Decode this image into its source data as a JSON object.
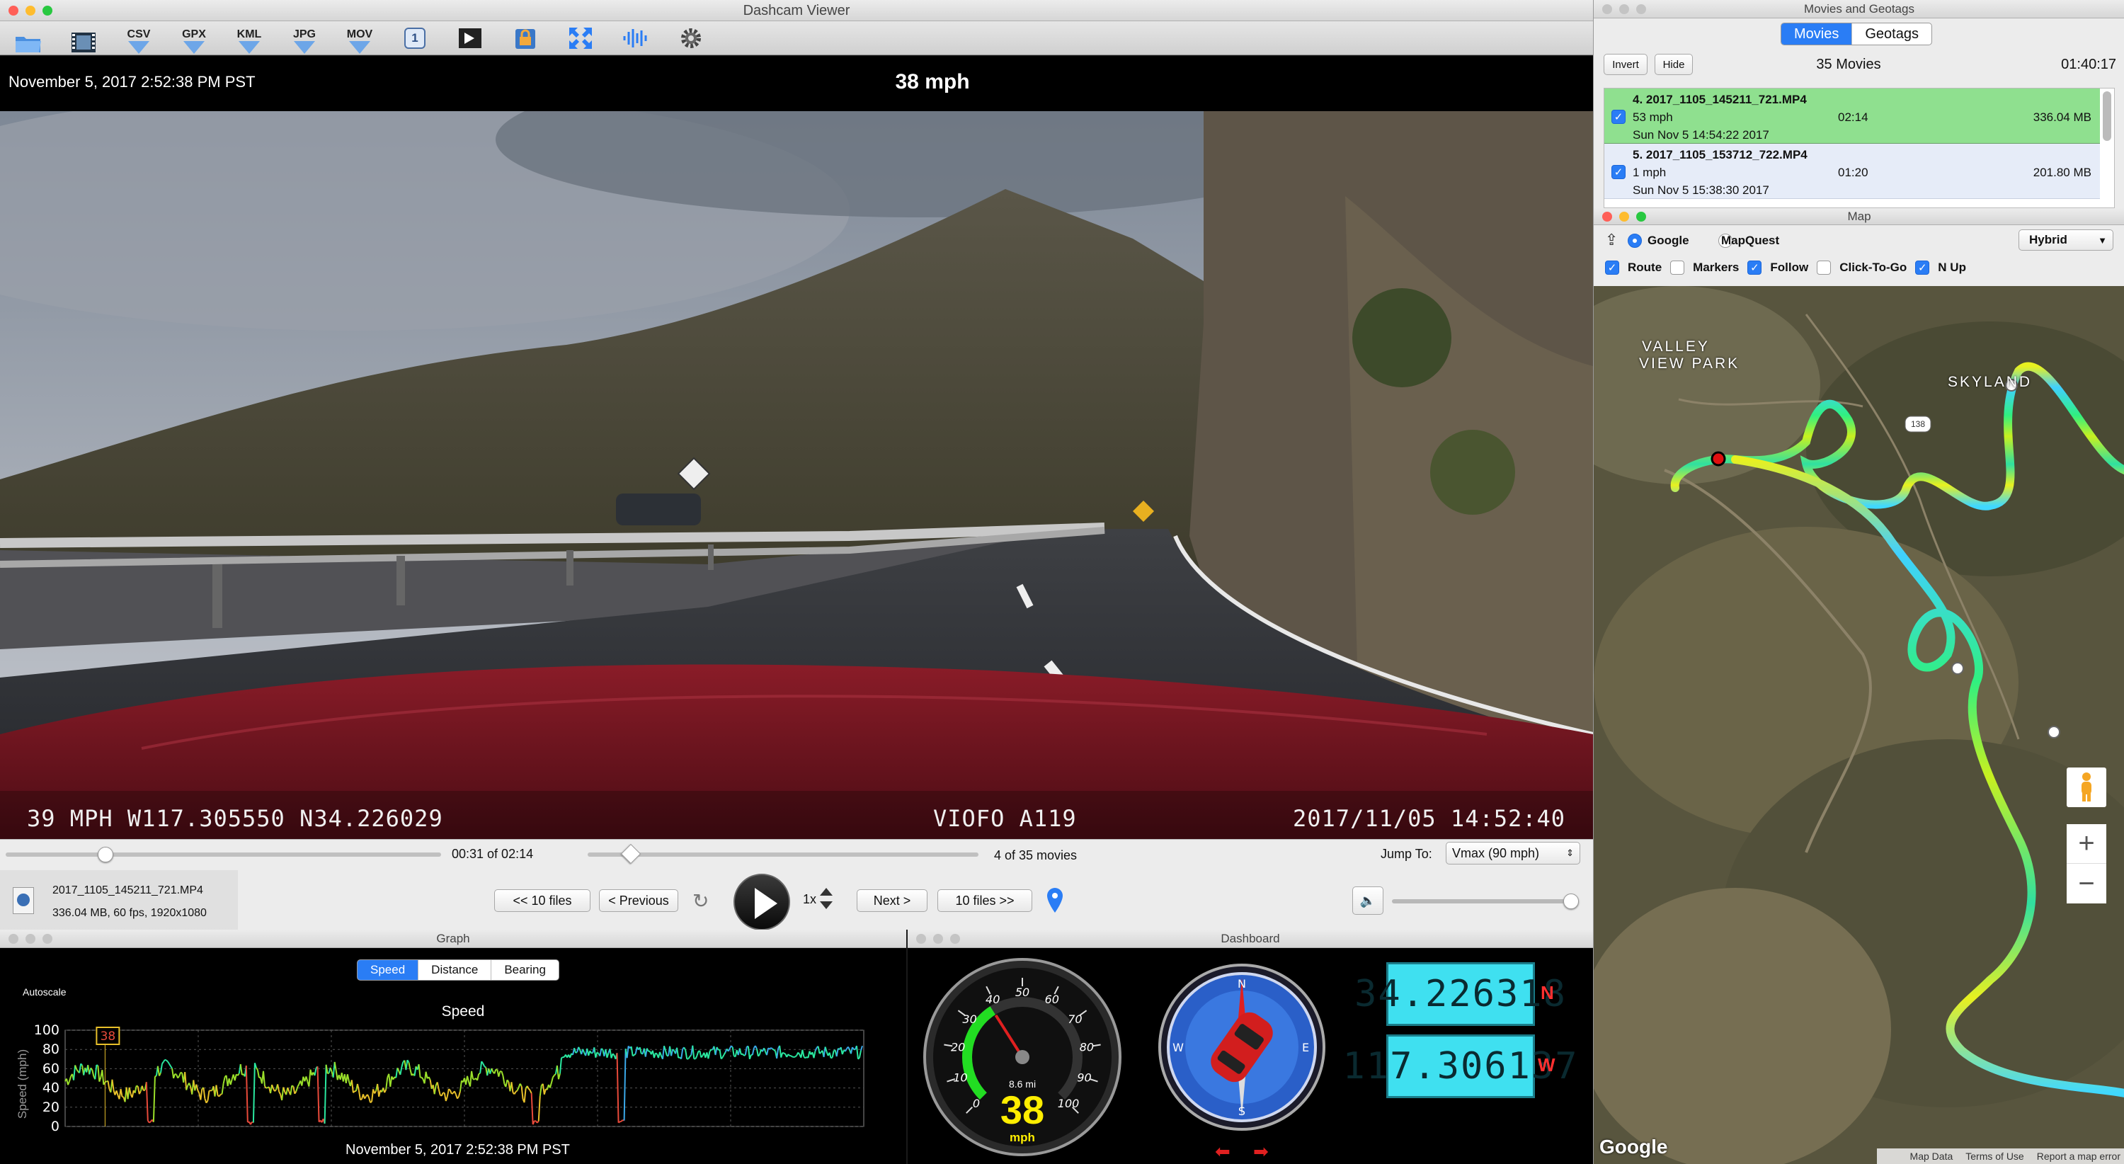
{
  "main_window": {
    "title": "Dashcam Viewer",
    "toolbar": [
      "folder-icon",
      "film-icon",
      "csv",
      "gpx",
      "kml",
      "jpg",
      "mov",
      "1",
      "movie-export-icon",
      "lock-icon",
      "fullscreen-icon",
      "audio-wave-icon",
      "gear-icon"
    ],
    "toolbar_labels": {
      "csv": "CSV",
      "gpx": "GPX",
      "kml": "KML",
      "jpg": "JPG",
      "mov": "MOV",
      "one": "1"
    },
    "header_datetime": "November 5, 2017 2:52:38 PM PST",
    "header_speed": "38 mph",
    "video_overlay": {
      "left": "39 MPH W117.305550 N34.226029",
      "center": "VIOFO A119",
      "right": "2017/11/05 14:52:40"
    },
    "time_label": "00:31 of 02:14",
    "movie_position": "4 of 35 movies",
    "jump_to_label": "Jump To:",
    "jump_to_value": "Vmax (90 mph)",
    "file_name": "2017_1105_145211_721.MP4",
    "file_info": "336.04 MB, 60 fps, 1920x1080",
    "buttons": {
      "back10": "<< 10 files",
      "previous": "< Previous",
      "next": "Next >",
      "fwd10": "10 files >>",
      "rate": "1x"
    },
    "playback_progress": 0.23,
    "movie_progress": 0.11,
    "volume": 1.0
  },
  "graph": {
    "title": "Graph",
    "tabs": [
      "Speed",
      "Distance",
      "Bearing"
    ],
    "active_tab": "Speed",
    "autoscale": "Autoscale",
    "chart_title": "Speed",
    "ylabel": "Speed (mph)",
    "yticks": [
      "100",
      "80",
      "60",
      "40",
      "20",
      "0"
    ],
    "marker": "38",
    "xlabel": "November 5, 2017 2:52:38 PM PST"
  },
  "dashboard": {
    "title": "Dashboard",
    "gauge_ticks": [
      "0",
      "10",
      "20",
      "30",
      "40",
      "50",
      "60",
      "70",
      "80",
      "90",
      "100"
    ],
    "distance": "8.6 mi",
    "speed": "38",
    "speed_unit": "mph",
    "lat": "34.226318",
    "lat_dir": "N",
    "lon": "117.306137",
    "lon_dir": "W",
    "compass": [
      "N",
      "E",
      "S",
      "W"
    ]
  },
  "movies_window": {
    "title": "Movies and Geotags",
    "tabs": [
      "Movies",
      "Geotags"
    ],
    "active_tab": "Movies",
    "invert": "Invert",
    "hide": "Hide",
    "count": "35 Movies",
    "total_time": "01:40:17",
    "items": [
      {
        "name": "4. 2017_1105_145211_721.MP4",
        "speed": "53 mph",
        "duration": "02:14",
        "size": "336.04 MB",
        "date": "Sun Nov 5 14:54:22 2017",
        "selected": true
      },
      {
        "name": "5. 2017_1105_153712_722.MP4",
        "speed": "1 mph",
        "duration": "01:20",
        "size": "201.80 MB",
        "date": "Sun Nov 5 15:38:30 2017",
        "selected": false
      }
    ]
  },
  "map_window": {
    "title": "Map",
    "providers": [
      "Google",
      "MapQuest"
    ],
    "active_provider": "Google",
    "map_type": "Hybrid",
    "options": [
      {
        "label": "Route",
        "checked": true
      },
      {
        "label": "Markers",
        "checked": false
      },
      {
        "label": "Follow",
        "checked": true
      },
      {
        "label": "Click-To-Go",
        "checked": false
      },
      {
        "label": "N Up",
        "checked": true
      }
    ],
    "place_labels": [
      "VALLEY",
      "VIEW PARK",
      "SKYLAND"
    ],
    "road_badge": "138",
    "google": "Google",
    "footer": [
      "Map Data",
      "Terms of Use",
      "Report a map error"
    ]
  },
  "colors": {
    "movie_selected": "#8fe08f",
    "accent": "#2a7df5",
    "lcd": "#3fe0f0",
    "alert": "#ff3030"
  }
}
